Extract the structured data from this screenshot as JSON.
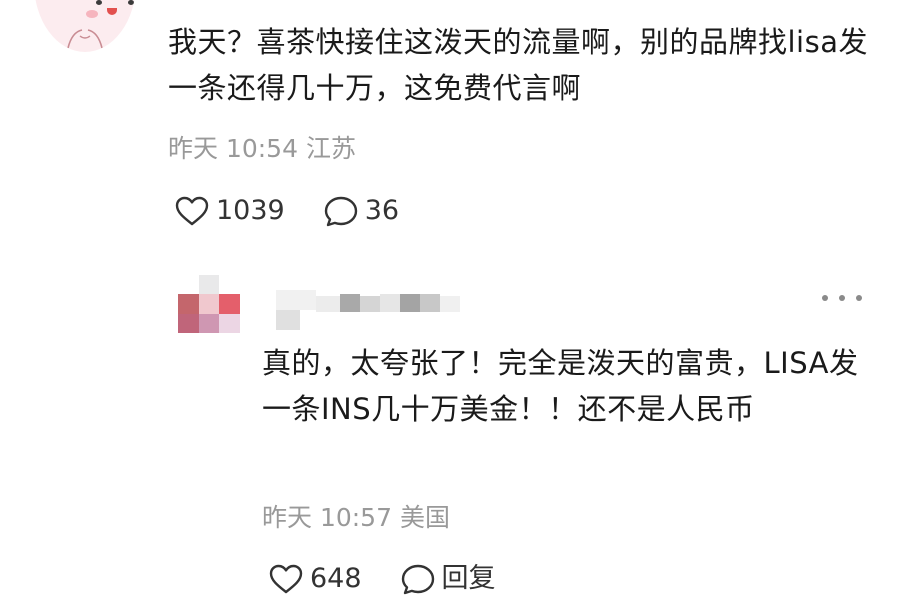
{
  "comment": {
    "text": "我天？喜茶快接住这泼天的流量啊，别的品牌找lisa发一条还得几十万，这免费代言啊",
    "time": "昨天 10:54",
    "location": "江苏",
    "likes": "1039",
    "replies": "36"
  },
  "reply": {
    "text": "真的，太夸张了！完全是泼天的富贵，LISA发一条INS几十万美金！！还不是人民币",
    "time": "昨天 10:57",
    "location": "美国",
    "likes": "648",
    "reply_label": "回复"
  },
  "icons": {
    "like": "heart-outline-icon",
    "comment": "speech-bubble-icon",
    "more": "more-dots-icon"
  },
  "colors": {
    "text": "#1a1a1a",
    "meta": "#999999",
    "icon": "#333333",
    "avatar_bg": "#fcecef"
  }
}
